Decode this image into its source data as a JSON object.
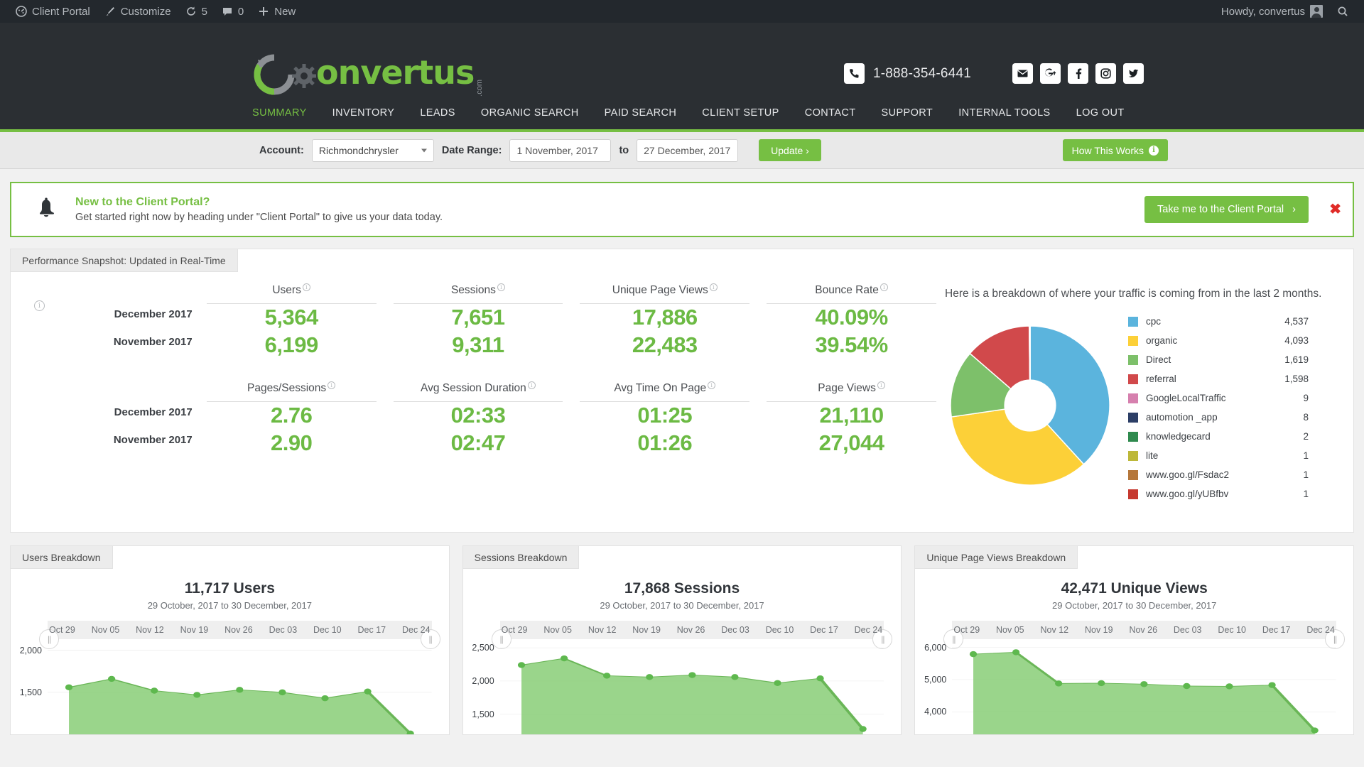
{
  "adminbar": {
    "site_name": "Client Portal",
    "customize": "Customize",
    "updates_count": "5",
    "comments_count": "0",
    "new": "New",
    "howdy": "Howdy, convertus"
  },
  "header": {
    "logo_text": "onvertus",
    "logo_dotcom": ".com",
    "phone": "1-888-354-6441",
    "social": [
      "email-icon",
      "googleplus-icon",
      "facebook-icon",
      "instagram-icon",
      "twitter-icon"
    ]
  },
  "nav": {
    "items": [
      {
        "label": "SUMMARY",
        "active": true
      },
      {
        "label": "INVENTORY",
        "active": false
      },
      {
        "label": "LEADS",
        "active": false
      },
      {
        "label": "ORGANIC SEARCH",
        "active": false
      },
      {
        "label": "PAID SEARCH",
        "active": false
      },
      {
        "label": "CLIENT SETUP",
        "active": false
      },
      {
        "label": "CONTACT",
        "active": false
      },
      {
        "label": "SUPPORT",
        "active": false
      },
      {
        "label": "INTERNAL TOOLS",
        "active": false
      },
      {
        "label": "LOG OUT",
        "active": false
      }
    ]
  },
  "filters": {
    "account_label": "Account:",
    "account_value": "Richmondchrysler",
    "date_label": "Date Range:",
    "date_from": "1 November, 2017",
    "to_word": "to",
    "date_to": "27 December, 2017",
    "update_label": "Update  ›",
    "how_this_works": "How This Works",
    "info_glyph": "i"
  },
  "alert": {
    "title": "New to the Client Portal?",
    "subtitle": "Get started right now by heading under \"Client Portal\" to give us your data today.",
    "button": "Take me to the Client Portal",
    "button_chevron": "›",
    "close_glyph": "✖"
  },
  "snapshot": {
    "tab_label": "Performance Snapshot: Updated in Real-Time",
    "info_glyph": "i",
    "tip_glyph": "i",
    "periods": [
      "December 2017",
      "November 2017"
    ],
    "rows": [
      {
        "metrics": [
          {
            "label": "Users",
            "dec": "5,364",
            "nov": "6,199"
          },
          {
            "label": "Sessions",
            "dec": "7,651",
            "nov": "9,311"
          },
          {
            "label": "Unique Page Views",
            "dec": "17,886",
            "nov": "22,483"
          },
          {
            "label": "Bounce Rate",
            "dec": "40.09%",
            "nov": "39.54%"
          }
        ]
      },
      {
        "metrics": [
          {
            "label": "Pages/Sessions",
            "dec": "2.76",
            "nov": "2.90"
          },
          {
            "label": "Avg Session Duration",
            "dec": "02:33",
            "nov": "02:47"
          },
          {
            "label": "Avg Time On Page",
            "dec": "01:25",
            "nov": "01:26"
          },
          {
            "label": "Page Views",
            "dec": "21,110",
            "nov": "27,044"
          }
        ]
      }
    ]
  },
  "chart_data": [
    {
      "type": "pie",
      "title": "Here is a breakdown of where your traffic is coming from in the last 2 months.",
      "legend_position": "right",
      "donut": true,
      "inner_radius_ratio": 0.32,
      "categories": [
        "cpc",
        "organic",
        "Direct",
        "referral",
        "GoogleLocalTraffic",
        "automotion _app",
        "knowledgecard",
        "lite",
        "www.goo.gl/Fsdac2",
        "www.goo.gl/yUBfbv"
      ],
      "values": [
        4537,
        4093,
        1619,
        1598,
        9,
        8,
        2,
        1,
        1,
        1
      ],
      "value_labels": [
        "4,537",
        "4,093",
        "1,619",
        "1,598",
        "9",
        "8",
        "2",
        "1",
        "1",
        "1"
      ],
      "colors": [
        "#5bb4dd",
        "#fcd038",
        "#7dc06a",
        "#d1494b",
        "#d680ae",
        "#2c3e66",
        "#2f8a4e",
        "#bdb83a",
        "#b5773b",
        "#c6392f"
      ]
    },
    {
      "type": "area",
      "tab_label": "Users Breakdown",
      "title": "11,717 Users",
      "subtitle": "29 October, 2017 to 30 December, 2017",
      "xlabel": "",
      "ylabel": "",
      "categories": [
        "Oct 29",
        "Nov 05",
        "Nov 12",
        "Nov 19",
        "Nov 26",
        "Dec 03",
        "Dec 10",
        "Dec 17",
        "Dec 24"
      ],
      "yticks": [
        "2,000",
        "1,500"
      ],
      "ylim": [
        1000,
        2150
      ],
      "values": [
        1560,
        1660,
        1520,
        1470,
        1530,
        1500,
        1430,
        1510,
        1010
      ],
      "color": "#7dc96a"
    },
    {
      "type": "area",
      "tab_label": "Sessions Breakdown",
      "title": "17,868 Sessions",
      "subtitle": "29 October, 2017 to 30 December, 2017",
      "xlabel": "",
      "ylabel": "",
      "categories": [
        "Oct 29",
        "Nov 05",
        "Nov 12",
        "Nov 19",
        "Nov 26",
        "Dec 03",
        "Dec 10",
        "Dec 17",
        "Dec 24"
      ],
      "yticks": [
        "2,500",
        "2,000",
        "1,500"
      ],
      "ylim": [
        1200,
        2650
      ],
      "values": [
        2240,
        2340,
        2080,
        2060,
        2090,
        2060,
        1970,
        2040,
        1280
      ],
      "color": "#7dc96a"
    },
    {
      "type": "area",
      "tab_label": "Unique Page Views Breakdown",
      "title": "42,471 Unique Views",
      "subtitle": "29 October, 2017 to 30 December, 2017",
      "xlabel": "",
      "ylabel": "",
      "categories": [
        "Oct 29",
        "Nov 05",
        "Nov 12",
        "Nov 19",
        "Nov 26",
        "Dec 03",
        "Dec 10",
        "Dec 17",
        "Dec 24"
      ],
      "yticks": [
        "6,000",
        "5,000",
        "4,000"
      ],
      "ylim": [
        3300,
        6300
      ],
      "values": [
        5790,
        5850,
        4880,
        4890,
        4860,
        4800,
        4790,
        4830,
        3420
      ],
      "color": "#7dc96a"
    }
  ]
}
